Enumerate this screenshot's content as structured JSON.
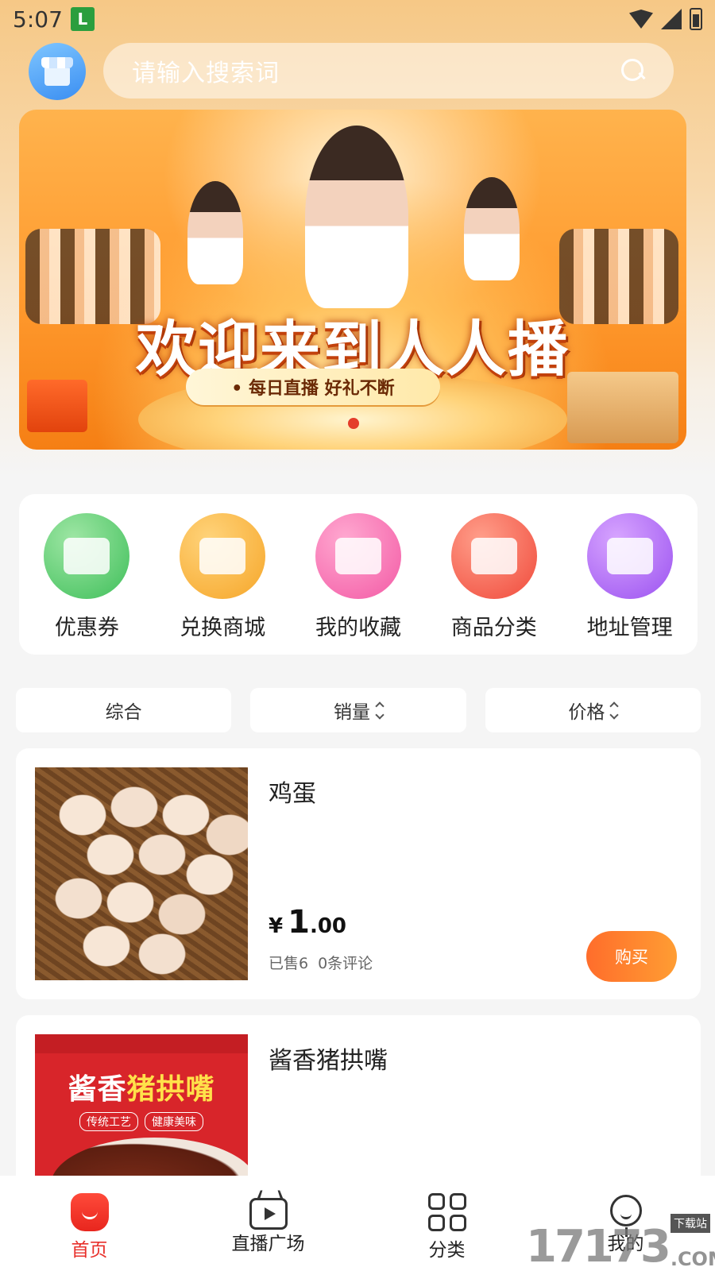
{
  "status_bar": {
    "time": "5:07",
    "app_icon_text": "L"
  },
  "search": {
    "placeholder": "请输入搜索词"
  },
  "banner": {
    "title": "欢迎来到人人播",
    "subtitle": "• 每日直播  好礼不断"
  },
  "quick_menu": [
    {
      "label": "优惠券",
      "icon": "coupon-icon"
    },
    {
      "label": "兑换商城",
      "icon": "exchange-mall-icon"
    },
    {
      "label": "我的收藏",
      "icon": "favorites-icon"
    },
    {
      "label": "商品分类",
      "icon": "category-icon"
    },
    {
      "label": "地址管理",
      "icon": "address-icon"
    }
  ],
  "sort_tabs": [
    {
      "label": "综合"
    },
    {
      "label": "销量"
    },
    {
      "label": "价格"
    }
  ],
  "products": [
    {
      "name": "鸡蛋",
      "price_symbol": "¥",
      "price_int": "1",
      "price_dec": ".00",
      "sold": "已售6",
      "reviews": "0条评论",
      "buy_label": "购买"
    },
    {
      "name": "酱香猪拱嘴",
      "image_title_a": "酱香",
      "image_title_b": "猪拱嘴",
      "image_tag_1": "传统工艺",
      "image_tag_2": "健康美味"
    }
  ],
  "bottom_nav": [
    {
      "label": "首页",
      "active": true
    },
    {
      "label": "直播广场"
    },
    {
      "label": "分类"
    },
    {
      "label": "我的"
    }
  ],
  "watermark": {
    "number": "17173",
    "site": "下载站",
    "suffix": ".COM"
  },
  "colors": {
    "accent": "#e8302b",
    "buy_gradient_start": "#ff6d2b",
    "buy_gradient_end": "#ff9d33"
  }
}
